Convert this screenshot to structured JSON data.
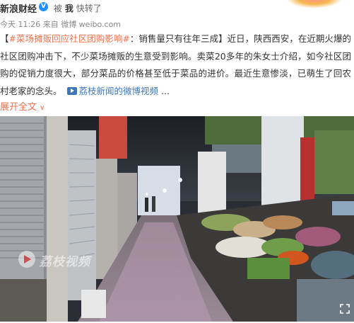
{
  "header": {
    "author": "新浪财经",
    "verified_badge": "V",
    "by_prefix": "被",
    "by_user": "我",
    "action": "快转了"
  },
  "meta": {
    "text": "今天 11:26 来自 微博 weibo.com"
  },
  "post": {
    "topic": "#菜场摊贩回应社区团购影响#",
    "body": "：销售量只有往年三成】近日，陕西西安，在近期火爆的社区团购冲击下，不少菜场摊贩的生意受到影响。卖菜20多年的朱女士介绍，如今社区团购的促销力度很大，部分菜品的价格甚至低于菜品的进价。最近生意惨淡，已萌生了回农村老家的念头。",
    "open_bracket": "【",
    "video_link": "荔枝新闻的微博视频",
    "ellipsis": "...",
    "expand_label": "展开全文",
    "expand_chevron": "∨"
  },
  "media": {
    "watermark": "荔枝视频",
    "accent_brand": "#eb7350",
    "link_color": "#3f77b8"
  }
}
